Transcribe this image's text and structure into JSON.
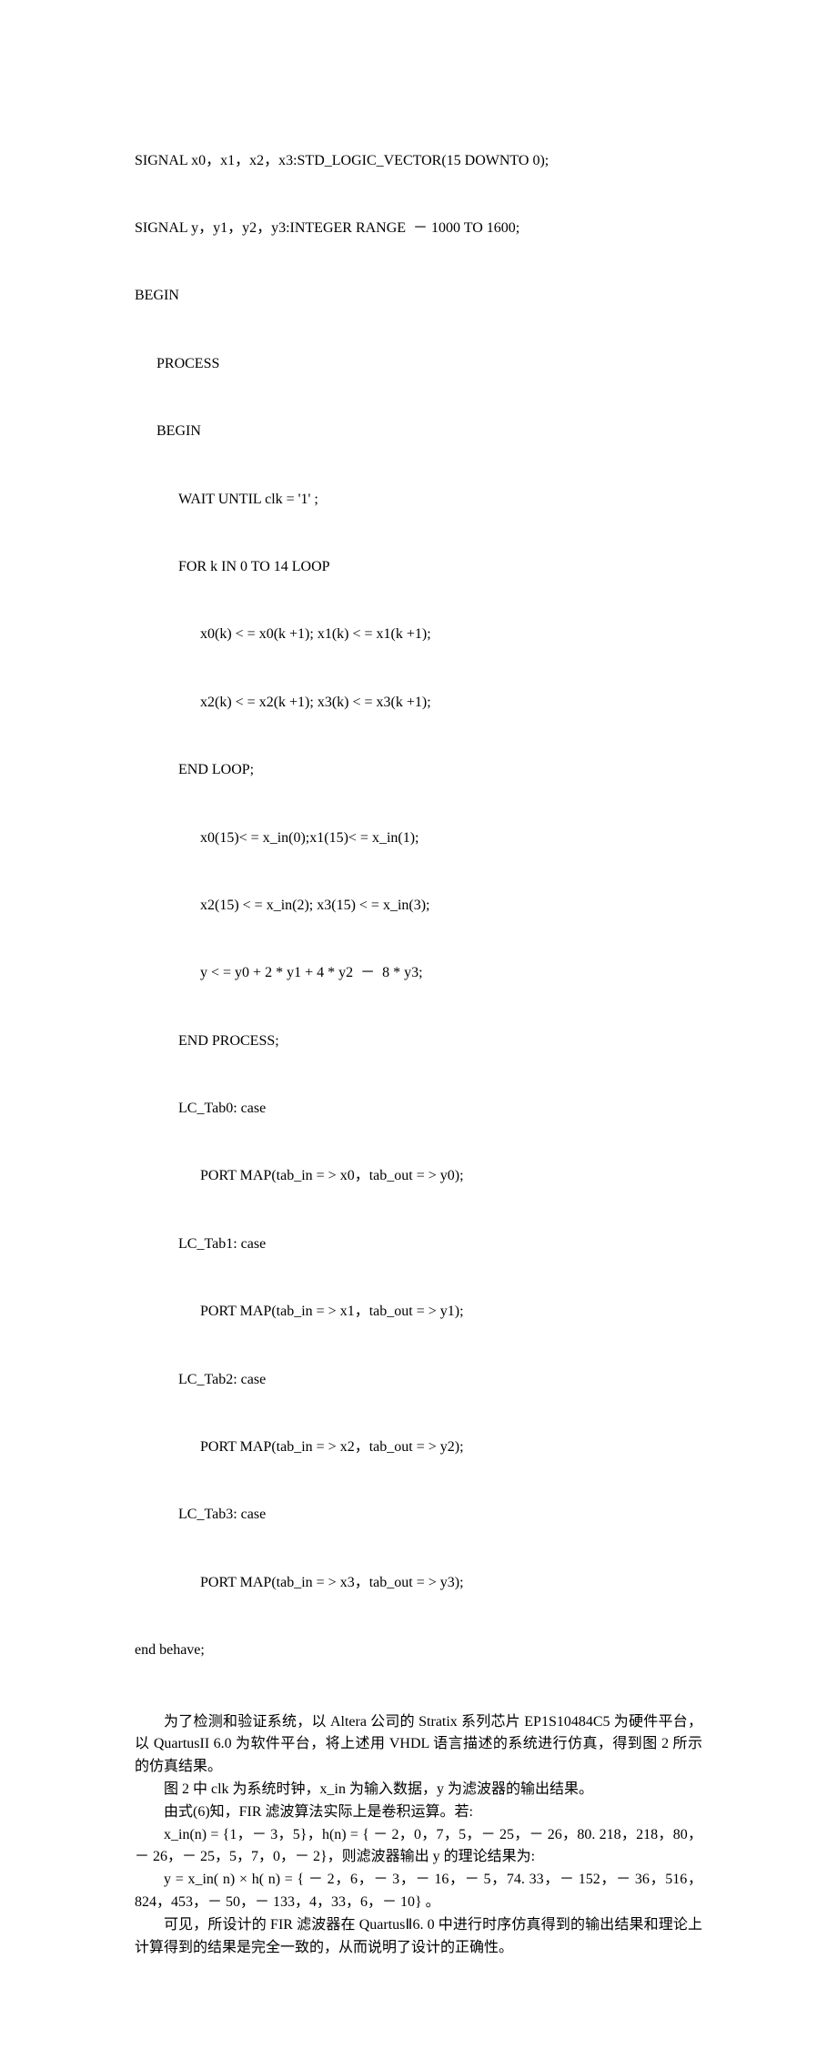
{
  "code": {
    "l1": "SIGNAL x0，x1，x2，x3:STD_LOGIC_VECTOR(15 DOWNTO 0);",
    "l2": "SIGNAL y，y1，y2，y3:INTEGER RANGE  － 1000 TO 1600;",
    "l3": "BEGIN",
    "l4": "PROCESS",
    "l5": "BEGIN",
    "l6": "WAIT UNTIL clk = '1' ;",
    "l7": "FOR k IN 0 TO 14 LOOP",
    "l8": "x0(k) < = x0(k +1); x1(k) < = x1(k +1);",
    "l9": "x2(k) < = x2(k +1); x3(k) < = x3(k +1);",
    "l10": "END LOOP;",
    "l11": "x0(15)< = x_in(0);x1(15)< = x_in(1);",
    "l12": "x2(15) < = x_in(2); x3(15) < = x_in(3);",
    "l13": "y < = y0 + 2 * y1 + 4 * y2  －  8 * y3;",
    "l14": "END PROCESS;",
    "l15": "LC_Tab0: case",
    "l16": "PORT MAP(tab_in = > x0，tab_out = > y0);",
    "l17": "LC_Tab1: case",
    "l18": "PORT MAP(tab_in = > x1，tab_out = > y1);",
    "l19": "LC_Tab2: case",
    "l20": "PORT MAP(tab_in = > x2，tab_out = > y2);",
    "l21": "LC_Tab3: case",
    "l22": "PORT MAP(tab_in = > x3，tab_out = > y3);",
    "l23": "end behave;"
  },
  "para1": "为了检测和验证系统，以 Altera 公司的 Stratix 系列芯片 EP1S10484C5 为硬件平台，以 QuartusII 6.0 为软件平台，将上述用 VHDL 语言描述的系统进行仿真，得到图 2 所示的仿真结果。",
  "para2": "图 2 中 clk 为系统时钟，x_in 为输入数据，y 为滤波器的输出结果。",
  "para3": "由式(6)知，FIR 滤波算法实际上是卷积运算。若:",
  "para4": "x_in(n) = {1，－ 3，5}，h(n) = { － 2，0，7，5，－ 25，－ 26，80. 218，218，80，－ 26，－ 25，5，7，0，－ 2}，则滤波器输出 y 的理论结果为:",
  "para5": "y = x_in( n) × h( n) = { － 2，6，－ 3，－ 16，－ 5，74. 33，－ 152，－ 36，516，824，453，－ 50，－ 133，4，33，6，－ 10} 。",
  "para6": "可见，所设计的 FIR 滤波器在 QuartusⅡ6. 0 中进行时序仿真得到的输出结果和理论上计算得到的结果是完全一致的，从而说明了设计的正确性。"
}
